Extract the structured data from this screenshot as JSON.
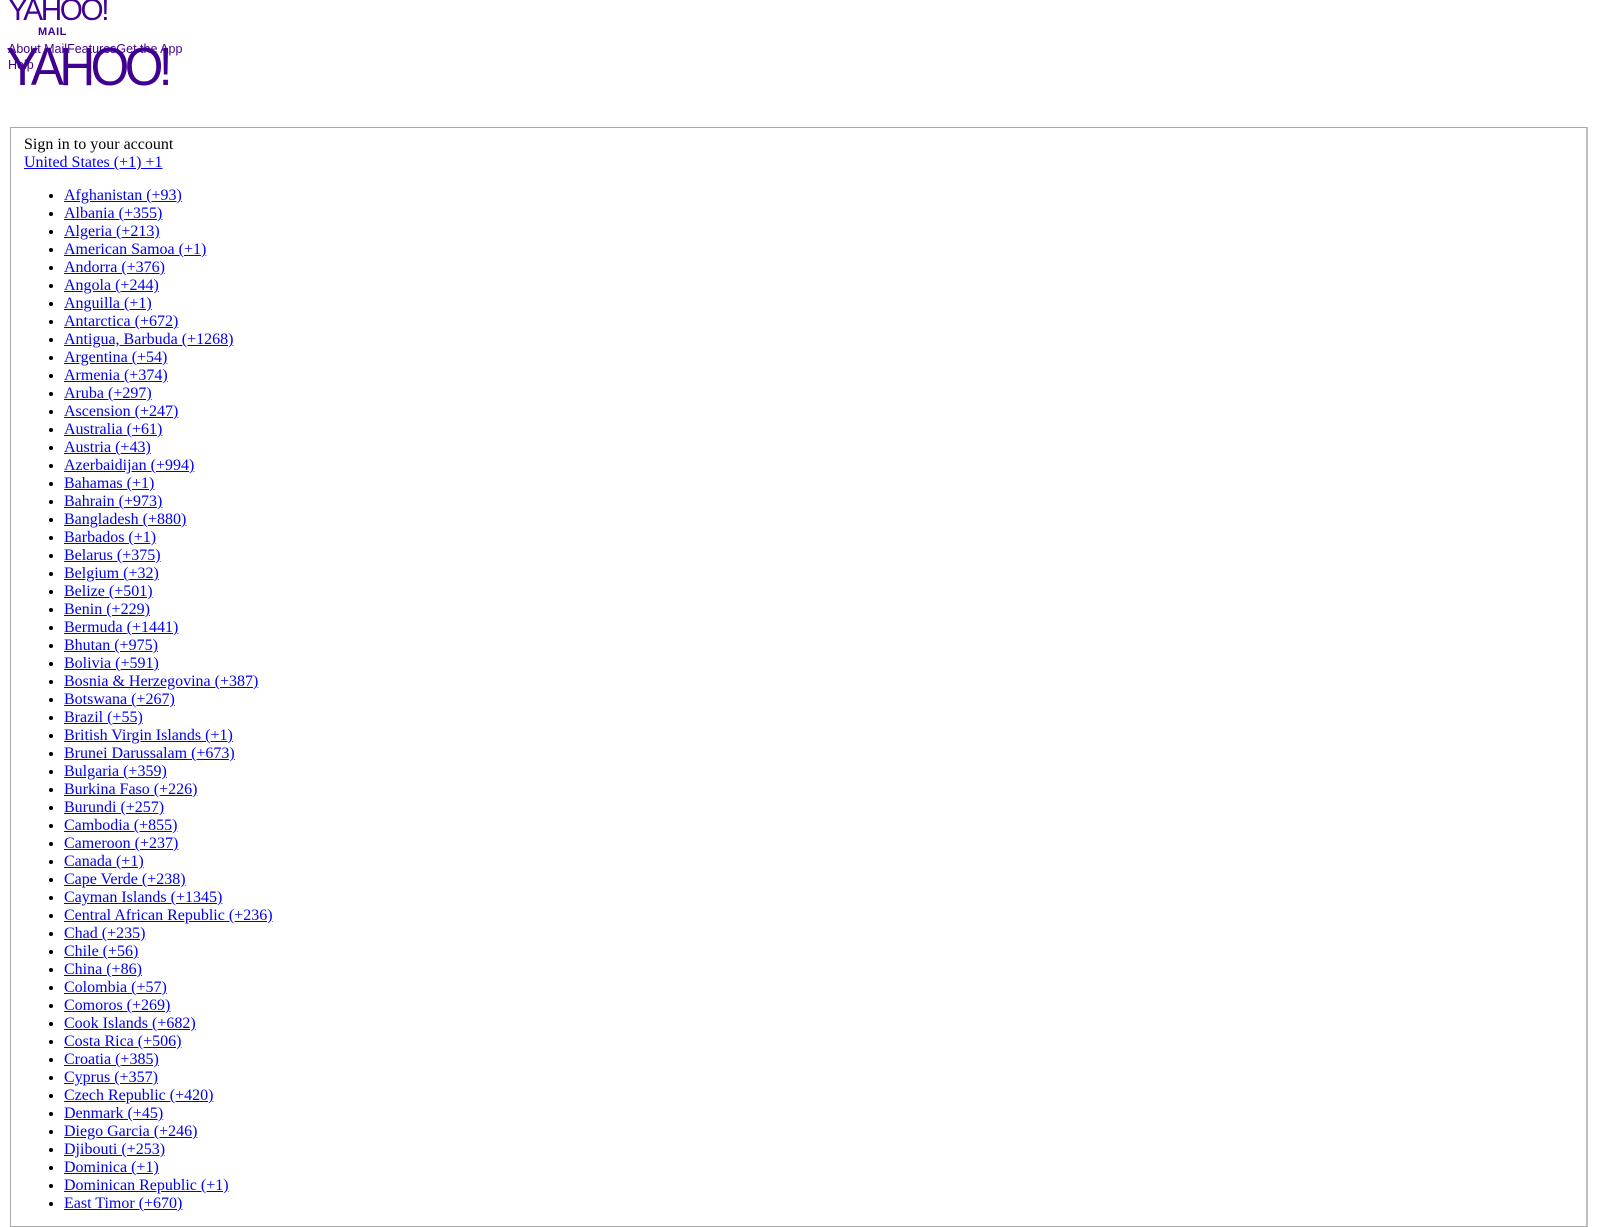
{
  "logo": {
    "top_wordmark": "YAHOO!",
    "top_sub": "MAIL",
    "main_wordmark": "YAHOO!"
  },
  "nav": {
    "about": "About Mail",
    "features": "Features",
    "app": "Get the App",
    "help": "Help"
  },
  "signin": {
    "title": "Sign in to your account",
    "current_country": "United States (+1) +1",
    "countries": [
      "Afghanistan (+93)",
      "Albania (+355)",
      "Algeria (+213)",
      "American Samoa (+1)",
      "Andorra (+376)",
      "Angola (+244)",
      "Anguilla (+1)",
      "Antarctica (+672)",
      "Antigua, Barbuda (+1268)",
      "Argentina (+54)",
      "Armenia (+374)",
      "Aruba (+297)",
      "Ascension (+247)",
      "Australia (+61)",
      "Austria (+43)",
      "Azerbaidijan (+994)",
      "Bahamas (+1)",
      "Bahrain (+973)",
      "Bangladesh (+880)",
      "Barbados (+1)",
      "Belarus (+375)",
      "Belgium (+32)",
      "Belize (+501)",
      "Benin (+229)",
      "Bermuda (+1441)",
      "Bhutan (+975)",
      "Bolivia (+591)",
      "Bosnia & Herzegovina (+387)",
      "Botswana (+267)",
      "Brazil (+55)",
      "British Virgin Islands (+1)",
      "Brunei Darussalam (+673)",
      "Bulgaria (+359)",
      "Burkina Faso (+226)",
      "Burundi (+257)",
      "Cambodia (+855)",
      "Cameroon (+237)",
      "Canada (+1)",
      "Cape Verde (+238)",
      "Cayman Islands (+1345)",
      "Central African Republic (+236)",
      "Chad (+235)",
      "Chile (+56)",
      "China (+86)",
      "Colombia (+57)",
      "Comoros (+269)",
      "Cook Islands (+682)",
      "Costa Rica (+506)",
      "Croatia (+385)",
      "Cyprus (+357)",
      "Czech Republic (+420)",
      "Denmark (+45)",
      "Diego Garcia (+246)",
      "Djibouti (+253)",
      "Dominica (+1)",
      "Dominican Republic (+1)",
      "East Timor (+670)"
    ]
  },
  "colors": {
    "brand": "#400090",
    "link": "#0000ee",
    "border": "#a9a9a9"
  }
}
